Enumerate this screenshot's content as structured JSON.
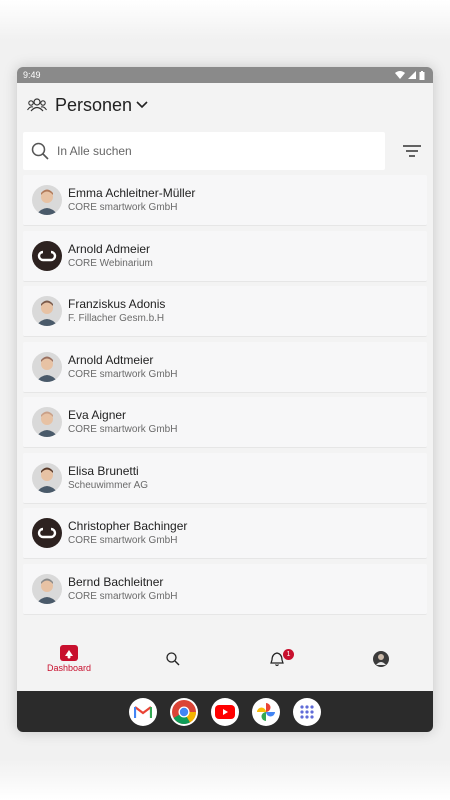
{
  "status_bar": {
    "time": "9:49"
  },
  "header": {
    "title": "Personen"
  },
  "search": {
    "placeholder": "In Alle suchen"
  },
  "persons": [
    {
      "name": "Emma Achleitner-Müller",
      "company": "CORE smartwork GmbH",
      "avatar": "photo-avatar"
    },
    {
      "name": "Arnold Admeier",
      "company": "CORE Webinarium",
      "avatar": "logo-avatar"
    },
    {
      "name": "Franziskus Adonis",
      "company": "F. Fillacher Gesm.b.H",
      "avatar": "photo-avatar"
    },
    {
      "name": "Arnold Adtmeier",
      "company": "CORE smartwork GmbH",
      "avatar": "photo-avatar"
    },
    {
      "name": "Eva Aigner",
      "company": "CORE smartwork GmbH",
      "avatar": "photo-avatar"
    },
    {
      "name": "Elisa Brunetti",
      "company": "Scheuwimmer AG",
      "avatar": "photo-avatar"
    },
    {
      "name": "Christopher Bachinger",
      "company": "CORE smartwork GmbH",
      "avatar": "logo-avatar"
    },
    {
      "name": "Bernd Bachleitner",
      "company": "CORE smartwork GmbH",
      "avatar": "photo-avatar"
    }
  ],
  "bottom_nav": {
    "dashboard_label": "Dashboard",
    "notification_count": "1"
  },
  "colors": {
    "accent": "#c8102e",
    "dock": "#2b2b2b"
  }
}
